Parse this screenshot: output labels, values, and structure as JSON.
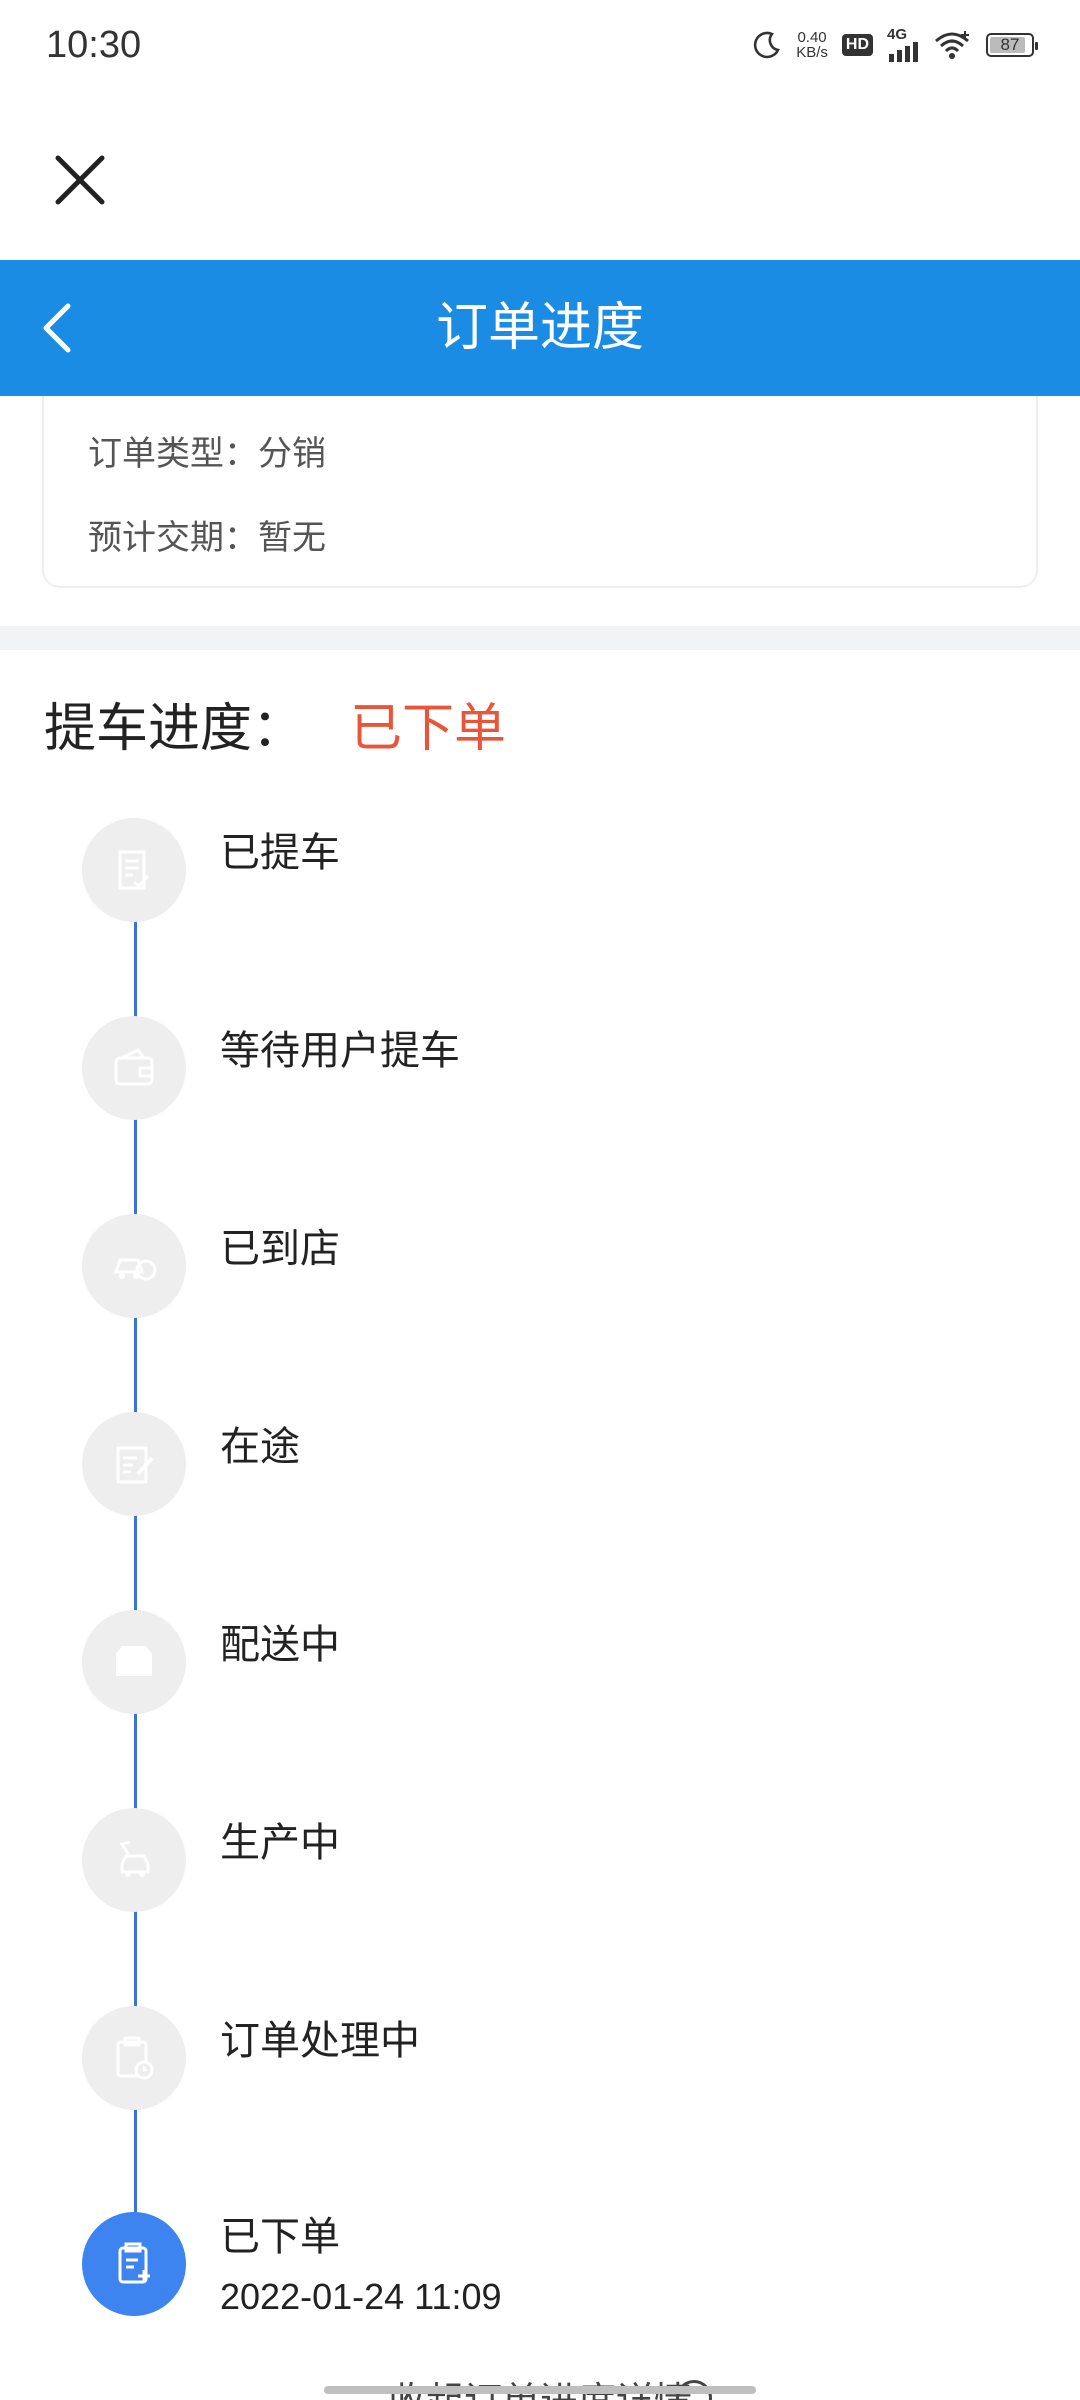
{
  "status_bar": {
    "time": "10:30",
    "net_speed_value": "0.40",
    "net_speed_unit": "KB/s",
    "hd_badge": "HD",
    "network": "4G",
    "battery": "87",
    "battery_level": 0.87,
    "icons": [
      "moon-icon",
      "signal-icon",
      "wifi-icon",
      "battery-icon"
    ]
  },
  "header": {
    "title": "订单进度"
  },
  "info": {
    "order_type": "订单类型：分销",
    "delivery": "预计交期：暂无"
  },
  "progress": {
    "title": "提车进度：",
    "status": "已下单",
    "status_color": "#e8563a",
    "line_color": "#3a74d8",
    "active_color": "#3d84f0",
    "steps": [
      {
        "label": "已提车",
        "icon": "document-check-icon",
        "active": false
      },
      {
        "label": "等待用户提车",
        "icon": "wallet-icon",
        "active": false
      },
      {
        "label": "已到店",
        "icon": "car-store-icon",
        "active": false
      },
      {
        "label": "在途",
        "icon": "edit-note-icon",
        "active": false
      },
      {
        "label": "配送中",
        "icon": "erp-icon",
        "active": false
      },
      {
        "label": "生产中",
        "icon": "production-icon",
        "active": false
      },
      {
        "label": "订单处理中",
        "icon": "clipboard-clock-icon",
        "active": false
      },
      {
        "label": "已下单",
        "icon": "clipboard-add-icon",
        "active": true,
        "time": "2022-01-24 11:09"
      }
    ]
  },
  "footer": {
    "collapse_label": "收起订单进度详情"
  },
  "colors": {
    "header_bg": "#1a8ce3"
  }
}
